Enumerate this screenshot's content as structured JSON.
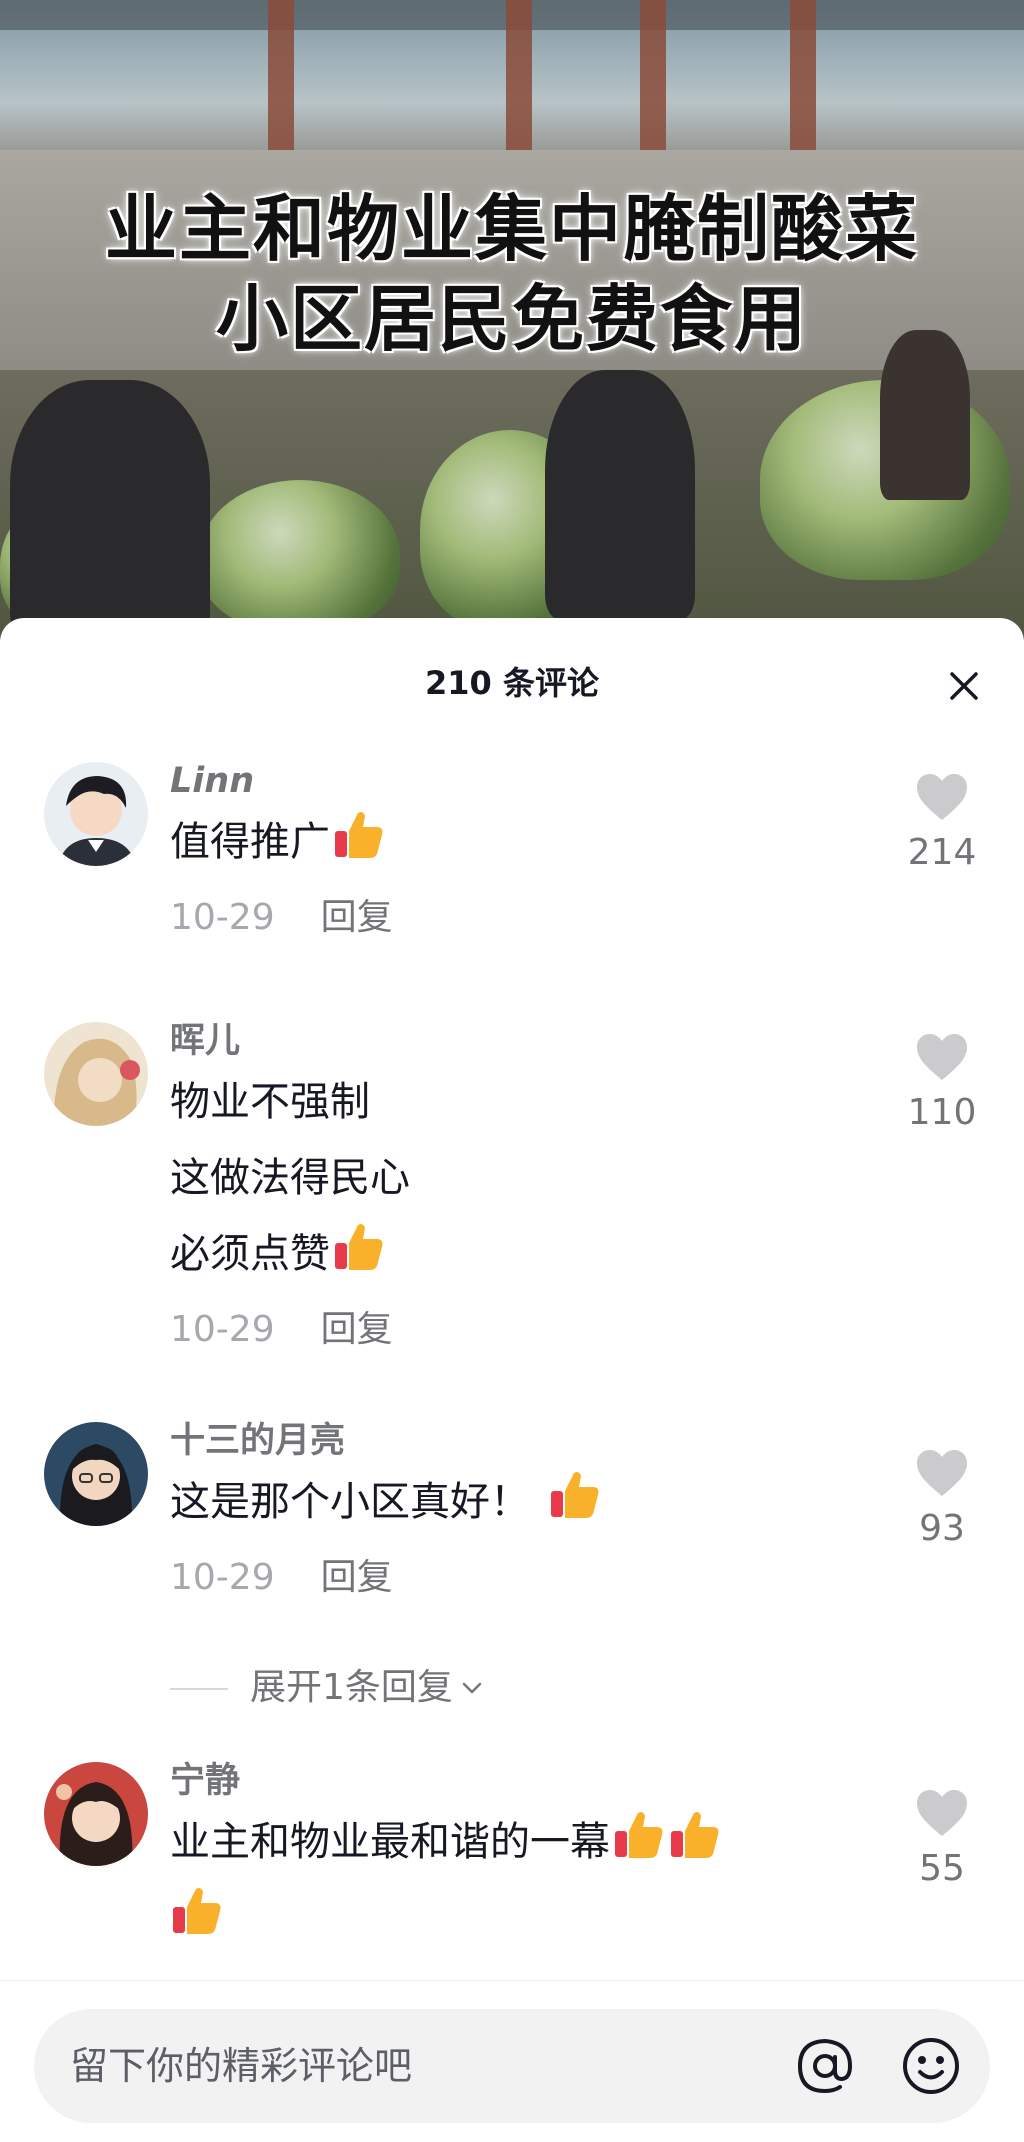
{
  "video": {
    "title_line_1": "业主和物业集中腌制酸菜",
    "title_line_2": "小区居民免费食用"
  },
  "sheet": {
    "title": "210 条评论",
    "close_icon": "close-icon"
  },
  "comments": [
    {
      "name": "Linn",
      "text": "值得推广",
      "thumbs": 1,
      "date": "10-29",
      "reply_label": "回复",
      "likes": "214"
    },
    {
      "name": "晖儿",
      "text": "物业不强制\n这做法得民心\n必须点赞",
      "thumbs": 1,
      "date": "10-29",
      "reply_label": "回复",
      "likes": "110"
    },
    {
      "name": "十三的月亮",
      "text": "这是那个小区真好！",
      "thumbs": 1,
      "date": "10-29",
      "reply_label": "回复",
      "likes": "93"
    },
    {
      "name": "宁静",
      "text": "业主和物业最和谐的一幕",
      "thumbs": 3,
      "likes": "55"
    }
  ],
  "expand_replies": "展开1条回复",
  "input": {
    "placeholder": "留下你的精彩评论吧"
  },
  "colors": {
    "primary_text": "#161823",
    "secondary_text": "#727478",
    "muted_text": "#a7a8ad",
    "like_icon": "#cbcbce"
  }
}
